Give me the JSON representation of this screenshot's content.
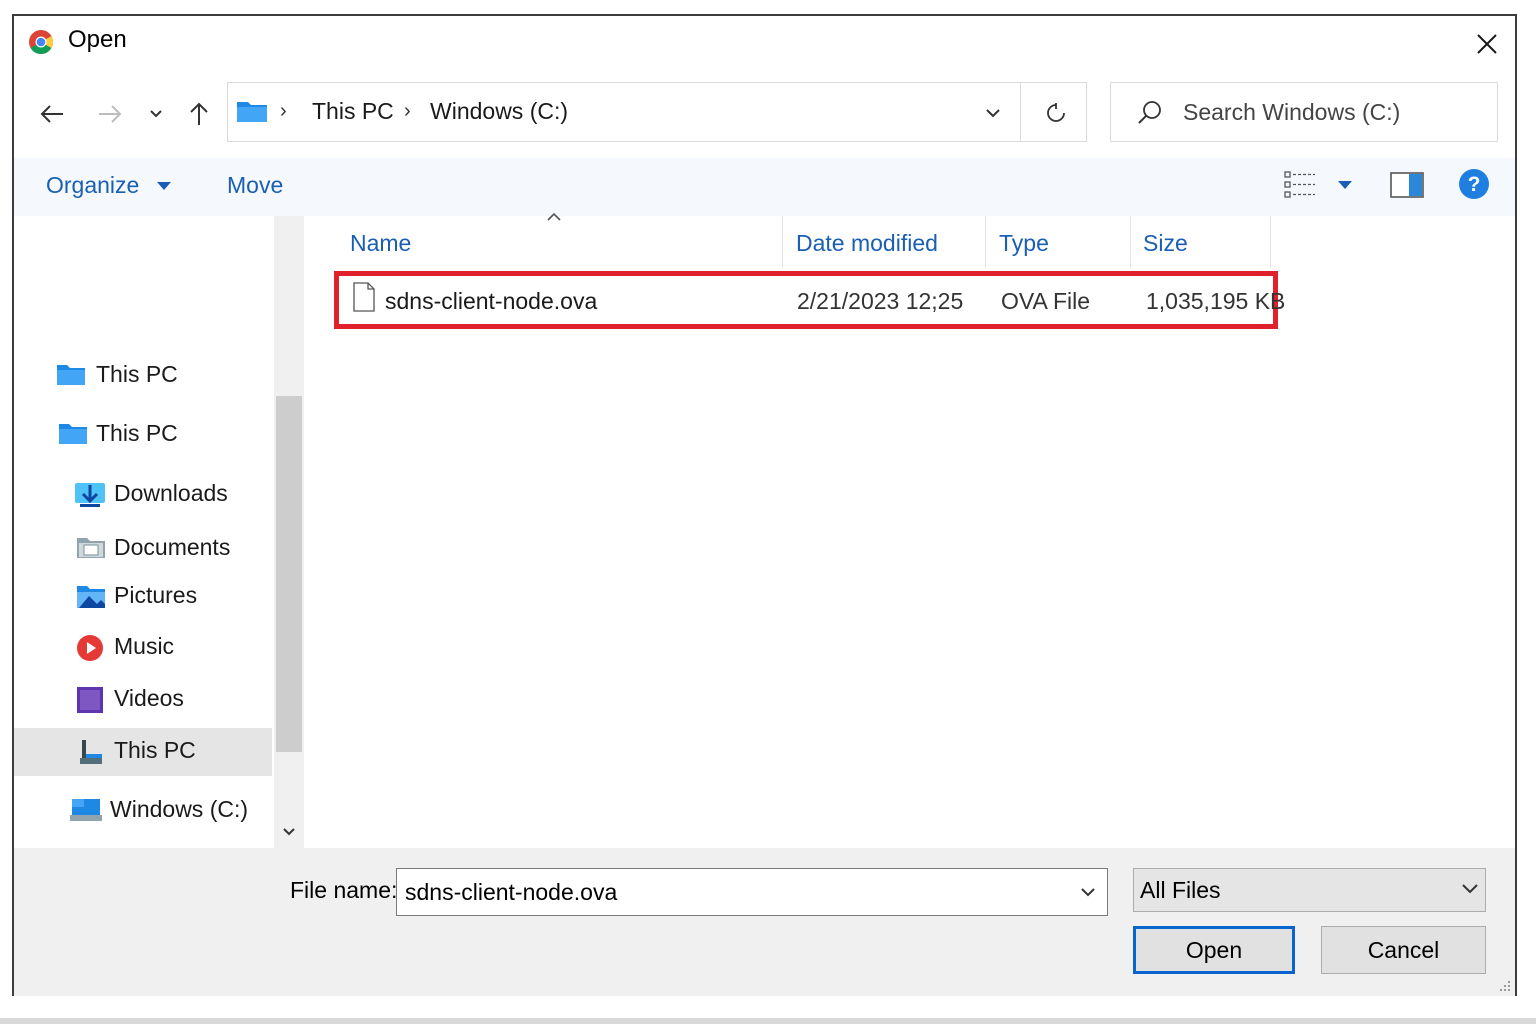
{
  "window": {
    "title": "Open"
  },
  "nav": {
    "breadcrumb": [
      "This PC",
      "Windows (C:)"
    ],
    "search_placeholder": "Search Windows (C:)"
  },
  "toolbar": {
    "organize_label": "Organize",
    "move_label": "Move"
  },
  "sidebar": {
    "items": [
      {
        "label": "This PC",
        "icon": "folder-icon"
      },
      {
        "label": "This PC",
        "icon": "folder-icon"
      },
      {
        "label": "Downloads",
        "icon": "downloads-icon"
      },
      {
        "label": "Documents",
        "icon": "documents-icon"
      },
      {
        "label": "Pictures",
        "icon": "pictures-icon"
      },
      {
        "label": "Music",
        "icon": "music-icon"
      },
      {
        "label": "Videos",
        "icon": "videos-icon"
      },
      {
        "label": "This PC",
        "icon": "computer-icon",
        "selected": true
      },
      {
        "label": "Windows (C:)",
        "icon": "drive-icon"
      }
    ]
  },
  "file_list": {
    "columns": [
      "Name",
      "Date modified",
      "Type",
      "Size"
    ],
    "rows": [
      {
        "name": "sdns-client-node.ova",
        "date": "2/21/2023 12;25",
        "type": "OVA File",
        "size": "1,035,195 KB"
      }
    ]
  },
  "bottom": {
    "file_name_label": "File name:",
    "file_name_value": "sdns-client-node.ova",
    "file_type": "All Files",
    "open_label": "Open",
    "cancel_label": "Cancel"
  },
  "colors": {
    "accent": "#1a5fb4",
    "highlight": "#e0202a",
    "primary_border": "#0a64d0"
  }
}
